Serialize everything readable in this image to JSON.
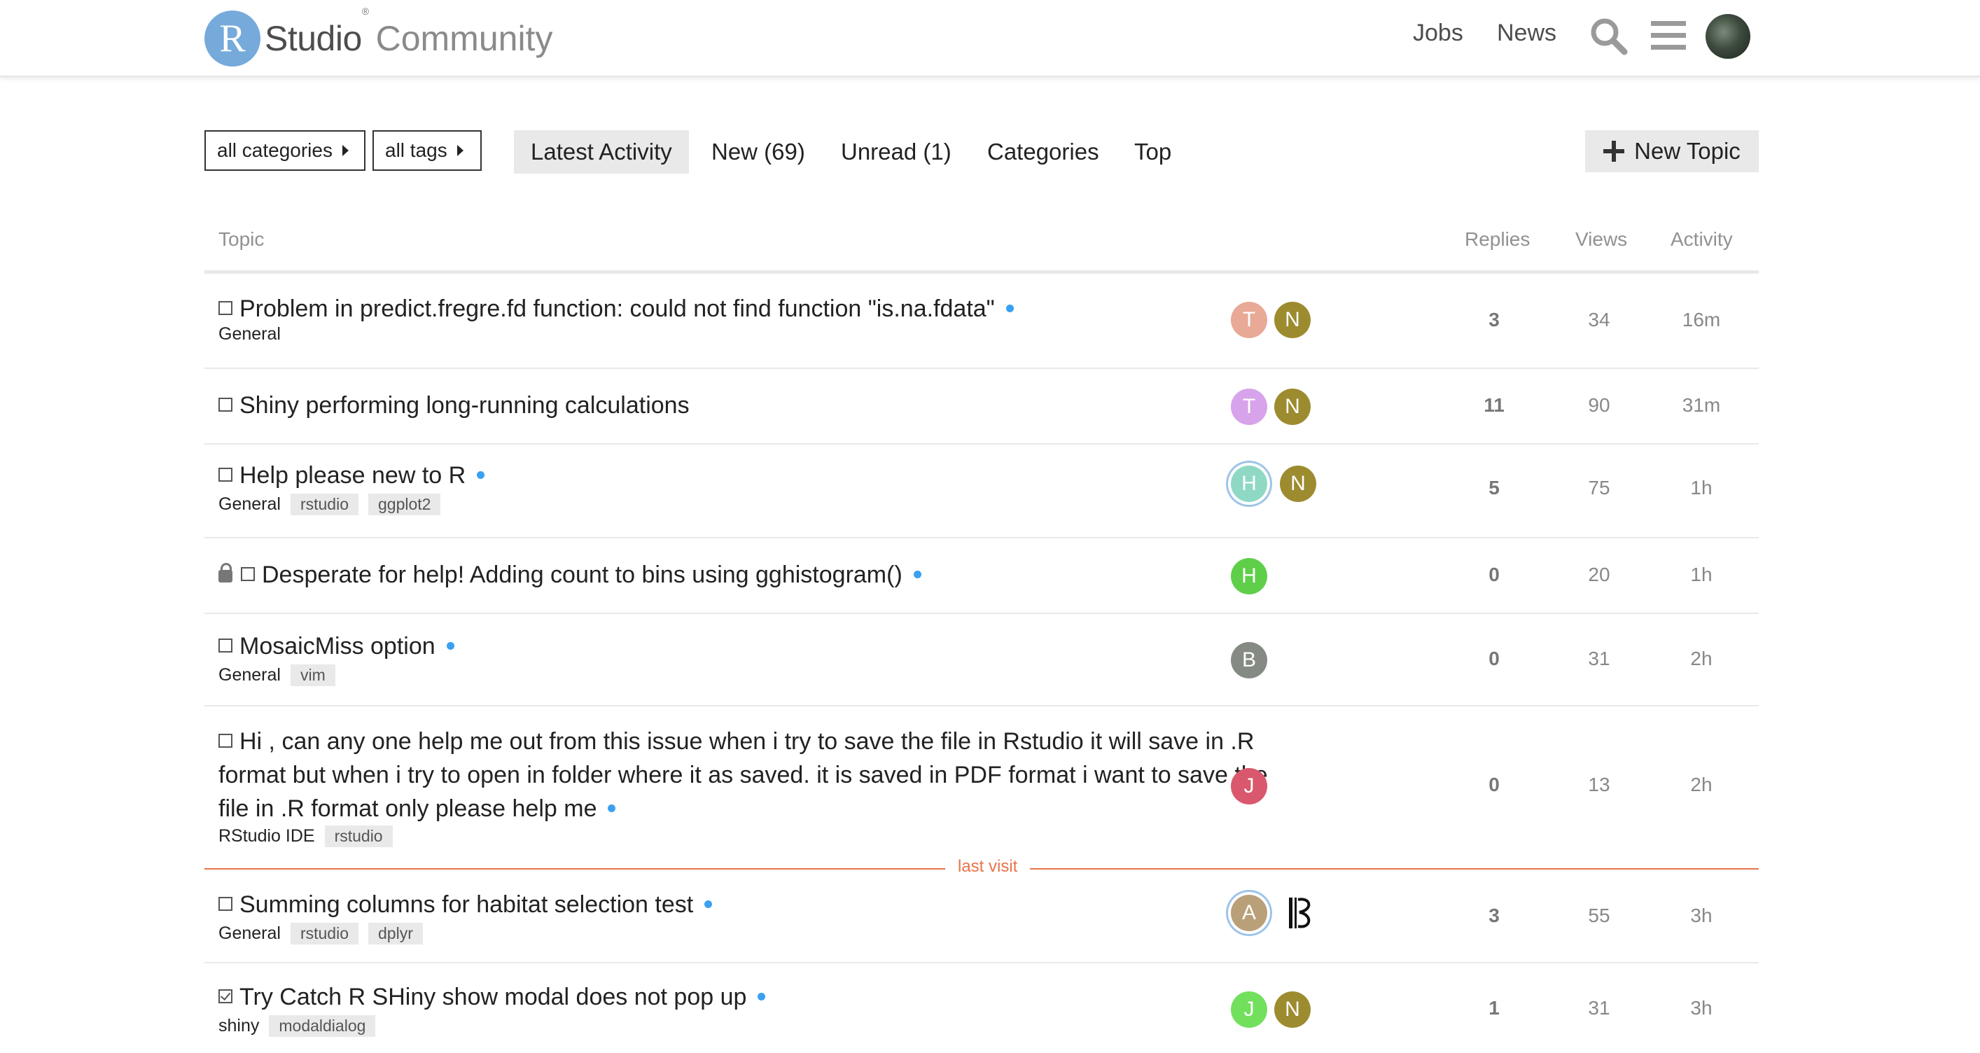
{
  "header": {
    "logo_letter": "R",
    "logo_studio": "Studio",
    "logo_reg": "®",
    "logo_community": "Community",
    "nav": [
      "Jobs",
      "News"
    ],
    "icons": [
      "search-icon",
      "hamburger-menu-icon",
      "user-avatar"
    ]
  },
  "filters": {
    "categories": "all categories",
    "tags": "all tags"
  },
  "tabs": [
    "Latest Activity",
    "New (69)",
    "Unread (1)",
    "Categories",
    "Top"
  ],
  "new_topic_label": "New Topic",
  "table_header": {
    "topic": "Topic",
    "replies": "Replies",
    "views": "Views",
    "activity": "Activity"
  },
  "topics": [
    {
      "title": "Problem in predict.fregre.fd function: could not find function \"is.na.fdata\"",
      "category": "General",
      "tags": [],
      "avatars": [
        {
          "letter": "T",
          "color": "#e8a997"
        },
        {
          "letter": "N",
          "color": "#9d8b2f"
        }
      ],
      "replies": "3",
      "views": "34",
      "activity": "16m",
      "unread": true
    },
    {
      "title": "Shiny performing long-running calculations",
      "category": "",
      "tags": [],
      "avatars": [
        {
          "letter": "T",
          "color": "#d7a3ea"
        },
        {
          "letter": "N",
          "color": "#9d8b2f"
        }
      ],
      "replies": "11",
      "views": "90",
      "activity": "31m",
      "unread": false
    },
    {
      "title": "Help please new to R",
      "category": "General",
      "tags": [
        "rstudio",
        "ggplot2"
      ],
      "avatars": [
        {
          "letter": "H",
          "color": "#8fd9c4"
        },
        {
          "letter": "N",
          "color": "#9d8b2f"
        }
      ],
      "replies": "5",
      "views": "75",
      "activity": "1h",
      "unread": true
    },
    {
      "title": "Desperate for help! Adding count to bins using gghistogram()",
      "category": "",
      "tags": [],
      "avatars": [
        {
          "letter": "H",
          "color": "#5fcf4a"
        }
      ],
      "replies": "0",
      "views": "20",
      "activity": "1h",
      "unread": true
    },
    {
      "title": "MosaicMiss option",
      "category": "General",
      "tags": [
        "vim"
      ],
      "avatars": [
        {
          "letter": "B",
          "color": "#858a84"
        }
      ],
      "replies": "0",
      "views": "31",
      "activity": "2h",
      "unread": true
    },
    {
      "title_lines": [
        "Hi , can any one help me out from this issue when i try to save the file in Rstudio it will save in .R",
        "format but when i try to open in folder where it as saved. it is saved in PDF format i want to save the",
        "file in .R format only please help me"
      ],
      "category": "RStudio IDE",
      "tags": [
        "rstudio"
      ],
      "avatars": [
        {
          "letter": "J",
          "color": "#d9586d"
        }
      ],
      "replies": "0",
      "views": "13",
      "activity": "2h",
      "unread": true
    },
    {
      "title": "Summing columns for habitat selection test",
      "category": "General",
      "tags": [
        "rstudio",
        "dplyr"
      ],
      "avatars": [
        {
          "letter": "A",
          "color": "#b9a079"
        }
      ],
      "replies": "3",
      "views": "55",
      "activity": "3h",
      "unread": true
    },
    {
      "title": "Try Catch R SHiny show modal does not pop up",
      "category": "shiny",
      "tags": [
        "modaldialog"
      ],
      "avatars": [
        {
          "letter": "J",
          "color": "#72e05c"
        },
        {
          "letter": "N",
          "color": "#9d8b2f"
        }
      ],
      "replies": "1",
      "views": "31",
      "activity": "3h",
      "unread": true
    }
  ],
  "last_visit_label": "last visit"
}
